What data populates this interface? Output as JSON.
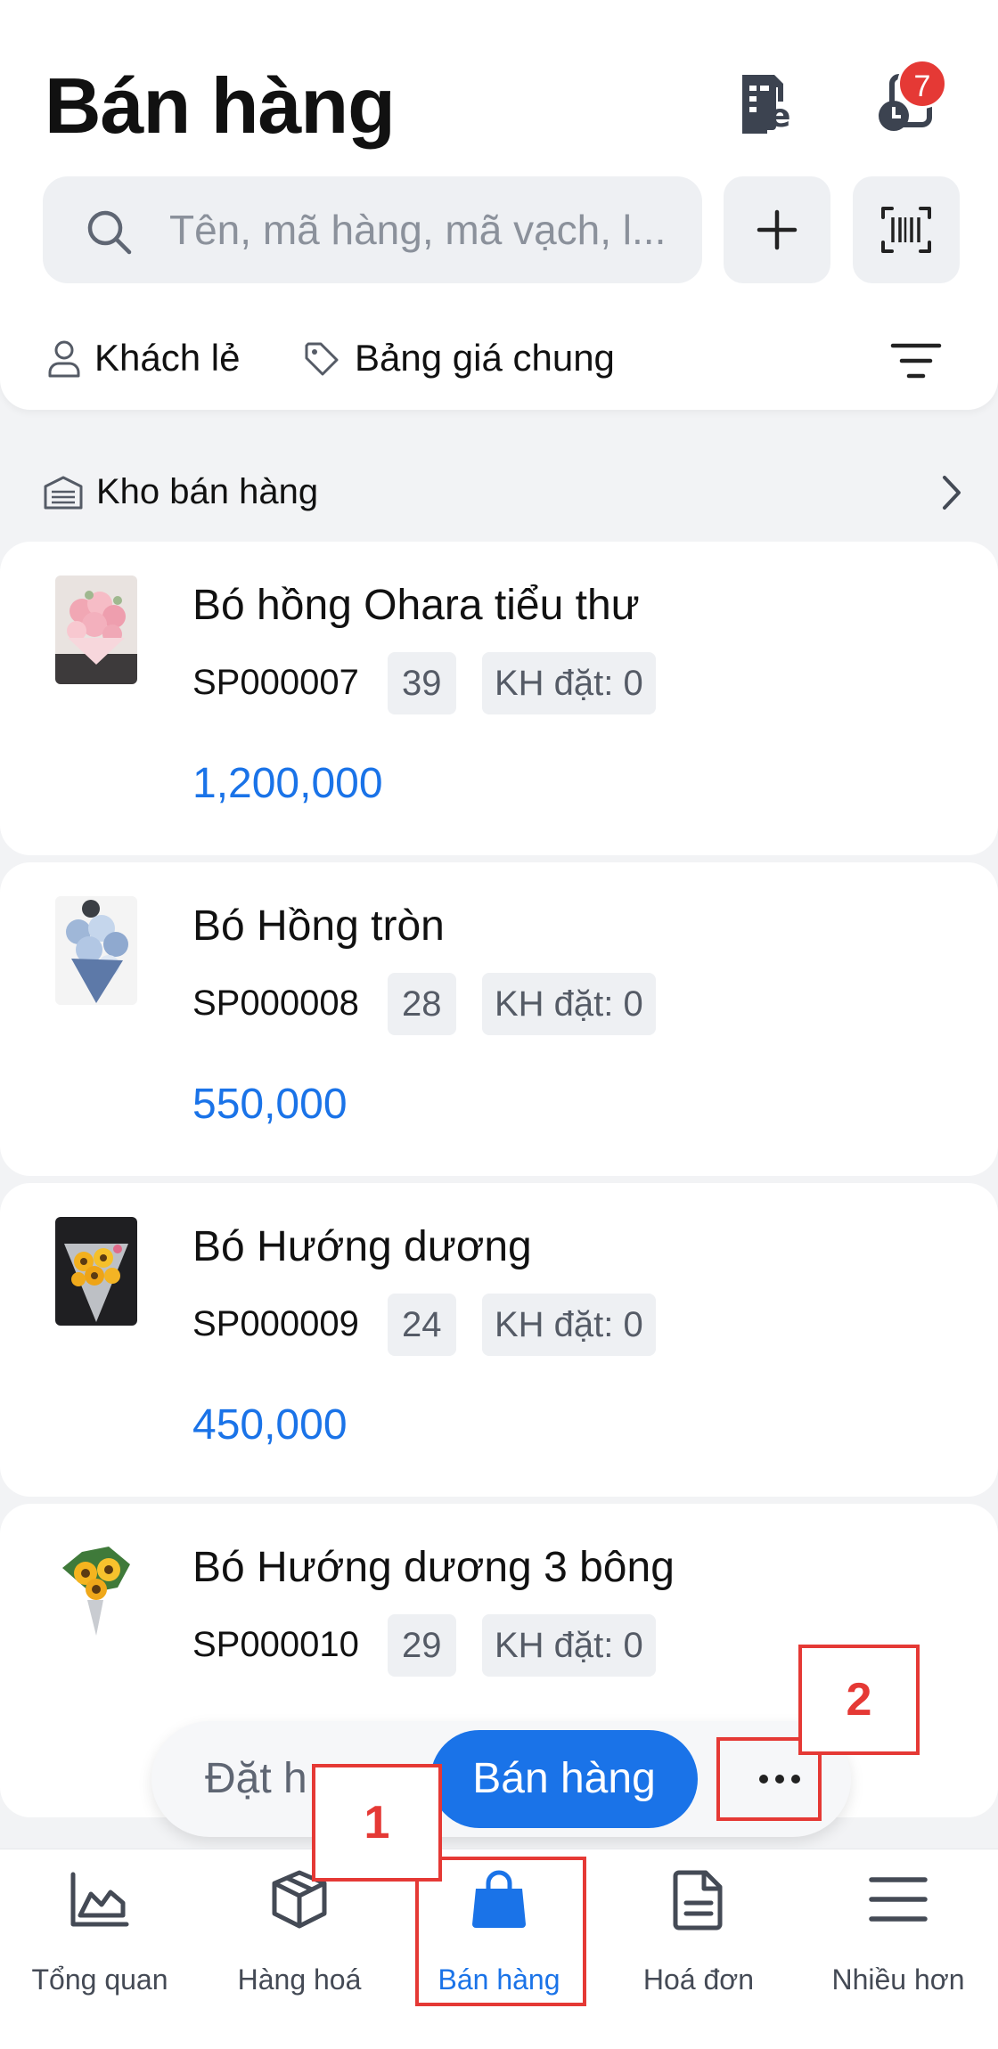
{
  "header": {
    "title": "Bán hàng",
    "notification_count": "7"
  },
  "search": {
    "placeholder": "Tên, mã hàng, mã vạch, l..."
  },
  "filters": {
    "customer": "Khách lẻ",
    "price_book": "Bảng giá chung"
  },
  "warehouse": {
    "label": "Kho bán hàng"
  },
  "products": [
    {
      "name": "Bó hồng Ohara tiểu thư",
      "code": "SP000007",
      "stock": "39",
      "ordered": "KH đặt: 0",
      "price": "1,200,000"
    },
    {
      "name": "Bó Hồng tròn",
      "code": "SP000008",
      "stock": "28",
      "ordered": "KH đặt: 0",
      "price": "550,000"
    },
    {
      "name": "Bó Hướng dương",
      "code": "SP000009",
      "stock": "24",
      "ordered": "KH đặt: 0",
      "price": "450,000"
    },
    {
      "name": "Bó Hướng dương 3 bông",
      "code": "SP000010",
      "stock": "29",
      "ordered": "KH đặt: 0"
    }
  ],
  "action_bar": {
    "order_label": "Đặt h",
    "sell_label": "Bán hàng"
  },
  "nav": [
    {
      "label": "Tổng quan",
      "icon": "chart-icon"
    },
    {
      "label": "Hàng hoá",
      "icon": "box-icon"
    },
    {
      "label": "Bán hàng",
      "icon": "shopping-bag-icon"
    },
    {
      "label": "Hoá đơn",
      "icon": "document-icon"
    },
    {
      "label": "Nhiều hơn",
      "icon": "menu-icon"
    }
  ],
  "annotations": {
    "one": "1",
    "two": "2"
  },
  "colors": {
    "accent": "#1a73e8",
    "badge": "#e53935",
    "annotation": "#e53935"
  }
}
